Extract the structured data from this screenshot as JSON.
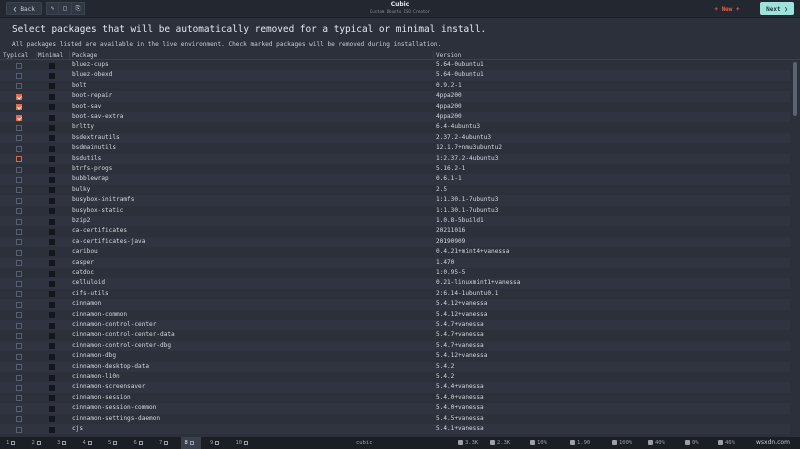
{
  "header": {
    "back_label": "❮ Back",
    "title": "Cubic",
    "subtitle": "Custom Ubuntu ISO Creator",
    "new_label": "+ New +",
    "next_label": "Next ❯",
    "tools": [
      "✎",
      "□",
      "⎘"
    ]
  },
  "instruction": "Select packages that will be automatically removed for a typical or minimal install.",
  "info": "All packages listed are available in the live environment. Check marked packages will be removed during installation.",
  "table": {
    "columns": {
      "typical": "Typical",
      "minimal": "Minimal",
      "package": "Package",
      "version": "Version"
    },
    "rows": [
      {
        "package": "bluez-cups",
        "version": "5.64-0ubuntu1",
        "typical": "none"
      },
      {
        "package": "bluez-obexd",
        "version": "5.64-0ubuntu1",
        "typical": "none"
      },
      {
        "package": "bolt",
        "version": "0.9.2-1",
        "typical": "none"
      },
      {
        "package": "boot-repair",
        "version": "4ppa200",
        "typical": "checked"
      },
      {
        "package": "boot-sav",
        "version": "4ppa200",
        "typical": "checked"
      },
      {
        "package": "boot-sav-extra",
        "version": "4ppa200",
        "typical": "checked"
      },
      {
        "package": "brltty",
        "version": "6.4-4ubuntu3",
        "typical": "none"
      },
      {
        "package": "bsdextrautils",
        "version": "2.37.2-4ubuntu3",
        "typical": "none"
      },
      {
        "package": "bsdmainutils",
        "version": "12.1.7+nmu3ubuntu2",
        "typical": "none"
      },
      {
        "package": "bsdutils",
        "version": "1:2.37.2-4ubuntu3",
        "typical": "outlined"
      },
      {
        "package": "btrfs-progs",
        "version": "5.16.2-1",
        "typical": "none"
      },
      {
        "package": "bubblewrap",
        "version": "0.6.1-1",
        "typical": "none"
      },
      {
        "package": "bulky",
        "version": "2.5",
        "typical": "none"
      },
      {
        "package": "busybox-initramfs",
        "version": "1:1.30.1-7ubuntu3",
        "typical": "none"
      },
      {
        "package": "busybox-static",
        "version": "1:1.30.1-7ubuntu3",
        "typical": "none"
      },
      {
        "package": "bzip2",
        "version": "1.0.8-5build1",
        "typical": "none"
      },
      {
        "package": "ca-certificates",
        "version": "20211016",
        "typical": "none"
      },
      {
        "package": "ca-certificates-java",
        "version": "20190909",
        "typical": "none"
      },
      {
        "package": "caribou",
        "version": "0.4.21+mint4+vanessa",
        "typical": "none"
      },
      {
        "package": "casper",
        "version": "1.470",
        "typical": "none"
      },
      {
        "package": "catdoc",
        "version": "1:0.95-5",
        "typical": "none"
      },
      {
        "package": "celluloid",
        "version": "0.21-linuxmint1+vanessa",
        "typical": "none"
      },
      {
        "package": "cifs-utils",
        "version": "2:6.14-1ubuntu0.1",
        "typical": "none"
      },
      {
        "package": "cinnamon",
        "version": "5.4.12+vanessa",
        "typical": "none"
      },
      {
        "package": "cinnamon-common",
        "version": "5.4.12+vanessa",
        "typical": "none"
      },
      {
        "package": "cinnamon-control-center",
        "version": "5.4.7+vanessa",
        "typical": "none"
      },
      {
        "package": "cinnamon-control-center-data",
        "version": "5.4.7+vanessa",
        "typical": "none"
      },
      {
        "package": "cinnamon-control-center-dbg",
        "version": "5.4.7+vanessa",
        "typical": "none"
      },
      {
        "package": "cinnamon-dbg",
        "version": "5.4.12+vanessa",
        "typical": "none"
      },
      {
        "package": "cinnamon-desktop-data",
        "version": "5.4.2",
        "typical": "none"
      },
      {
        "package": "cinnamon-l10n",
        "version": "5.4.2",
        "typical": "none"
      },
      {
        "package": "cinnamon-screensaver",
        "version": "5.4.4+vanessa",
        "typical": "none"
      },
      {
        "package": "cinnamon-session",
        "version": "5.4.0+vanessa",
        "typical": "none"
      },
      {
        "package": "cinnamon-session-common",
        "version": "5.4.0+vanessa",
        "typical": "none"
      },
      {
        "package": "cinnamon-settings-daemon",
        "version": "5.4.5+vanessa",
        "typical": "none"
      },
      {
        "package": "cjs",
        "version": "5.4.1+vanessa",
        "typical": "none"
      }
    ]
  },
  "statusbar": {
    "workspaces": [
      "1",
      "2",
      "3",
      "4",
      "5",
      "6",
      "7",
      "8",
      "9",
      "10"
    ],
    "active_workspace": "8",
    "app": "cubic",
    "items": [
      "3.3K",
      "2.3K",
      "10%",
      "1.90",
      "100%",
      "40%",
      "0%",
      "46%"
    ],
    "watermark": "wsxdn.com"
  },
  "colors": {
    "accent": "#e26b4a",
    "next": "#9fe2dc",
    "background": "#2b303b"
  }
}
